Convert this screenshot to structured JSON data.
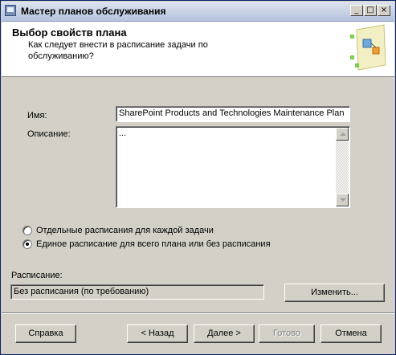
{
  "window": {
    "title": "Мастер планов обслуживания"
  },
  "header": {
    "title": "Выбор свойств плана",
    "subtitle": "Как следует внести в расписание задачи по обслуживанию?"
  },
  "form": {
    "name_label": "Имя:",
    "name_value": "SharePoint Products and Technologies Maintenance Plan",
    "description_label": "Описание:",
    "description_value": "...",
    "radio_separate_label": "Отдельные расписания для каждой задачи",
    "radio_single_label": "Единое расписание для всего плана или без расписания",
    "selected_radio": "single",
    "schedule_label": "Расписание:",
    "schedule_value": "Без расписания (по требованию)",
    "change_button": "Изменить..."
  },
  "footer": {
    "help": "Справка",
    "back": "< Назад",
    "next": "Далее >",
    "finish": "Готово",
    "cancel": "Отмена"
  }
}
